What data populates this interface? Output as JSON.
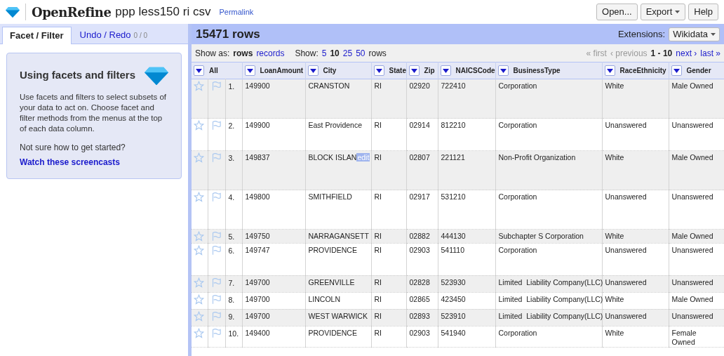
{
  "header": {
    "app_name": "OpenRefine",
    "project_name": "ppp less150 ri csv",
    "permalink": "Permalink",
    "buttons": [
      {
        "label": "Open...",
        "dropdown": false
      },
      {
        "label": "Export",
        "dropdown": true
      },
      {
        "label": "Help",
        "dropdown": false
      }
    ]
  },
  "left_tabs": [
    {
      "label": "Facet / Filter",
      "selected": true
    },
    {
      "label": "Undo / Redo",
      "count": "0 / 0",
      "selected": false
    }
  ],
  "help_card": {
    "title": "Using facets and filters",
    "body": "Use facets and filters to select subsets of your data to act on. Choose facet and filter methods from the menus at the top of each data column.",
    "prompt": "Not sure how to get started?",
    "link": "Watch these screencasts"
  },
  "summary": {
    "row_count": "15471 rows",
    "extensions_label": "Extensions:",
    "extensions_button": "Wikidata"
  },
  "view_bar": {
    "show_as_label": "Show as:",
    "modes": [
      {
        "label": "rows",
        "selected": true
      },
      {
        "label": "records",
        "selected": false
      }
    ],
    "show_label": "Show:",
    "page_sizes": [
      {
        "label": "5",
        "selected": false
      },
      {
        "label": "10",
        "selected": true
      },
      {
        "label": "25",
        "selected": false
      },
      {
        "label": "50",
        "selected": false
      }
    ],
    "rows_label": "rows",
    "first": "« first",
    "previous": "‹ previous",
    "range": "1 - 10",
    "next": "next ›",
    "last": "last »"
  },
  "table": {
    "columns": [
      "All",
      "LoanAmount",
      "City",
      "State",
      "Zip",
      "NAICSCode",
      "BusinessType",
      "RaceEthnicity",
      "Gender"
    ],
    "rows": [
      {
        "cells": [
          "1.",
          "149900",
          "CRANSTON",
          "RI",
          "02920",
          "722410",
          "Corporation",
          "White",
          "Male Owned"
        ]
      },
      {
        "cells": [
          "2.",
          "149900",
          "East Providence",
          "RI",
          "02914",
          "812210",
          "Corporation",
          "Unanswered",
          "Unanswered"
        ]
      },
      {
        "cells": [
          "3.",
          "149837",
          "BLOCK ISLAN",
          "RI",
          "02807",
          "221121",
          "Non-Profit Organization",
          "White",
          "Male Owned"
        ],
        "edit": "edit"
      },
      {
        "cells": [
          "4.",
          "149800",
          "SMITHFIELD",
          "RI",
          "02917",
          "531210",
          "Corporation",
          "Unanswered",
          "Unanswered"
        ]
      },
      {
        "cells": [
          "5.",
          "149750",
          "NARRAGANSETT",
          "RI",
          "02882",
          "444130",
          "Subchapter S Corporation",
          "White",
          "Male Owned"
        ]
      },
      {
        "cells": [
          "6.",
          "149747",
          "PROVIDENCE",
          "RI",
          "02903",
          "541110",
          "Corporation",
          "Unanswered",
          "Unanswered"
        ]
      },
      {
        "cells": [
          "7.",
          "149700",
          "GREENVILLE",
          "RI",
          "02828",
          "523930",
          "Limited  Liability Company(LLC)",
          "Unanswered",
          "Unanswered"
        ]
      },
      {
        "cells": [
          "8.",
          "149700",
          "LINCOLN",
          "RI",
          "02865",
          "423450",
          "Limited  Liability Company(LLC)",
          "White",
          "Male Owned"
        ]
      },
      {
        "cells": [
          "9.",
          "149700",
          "WEST WARWICK",
          "RI",
          "02893",
          "523910",
          "Limited  Liability Company(LLC)",
          "Unanswered",
          "Unanswered"
        ]
      },
      {
        "cells": [
          "10.",
          "149400",
          "PROVIDENCE",
          "RI",
          "02903",
          "541940",
          "Corporation",
          "White",
          "Female Owned"
        ]
      }
    ]
  }
}
